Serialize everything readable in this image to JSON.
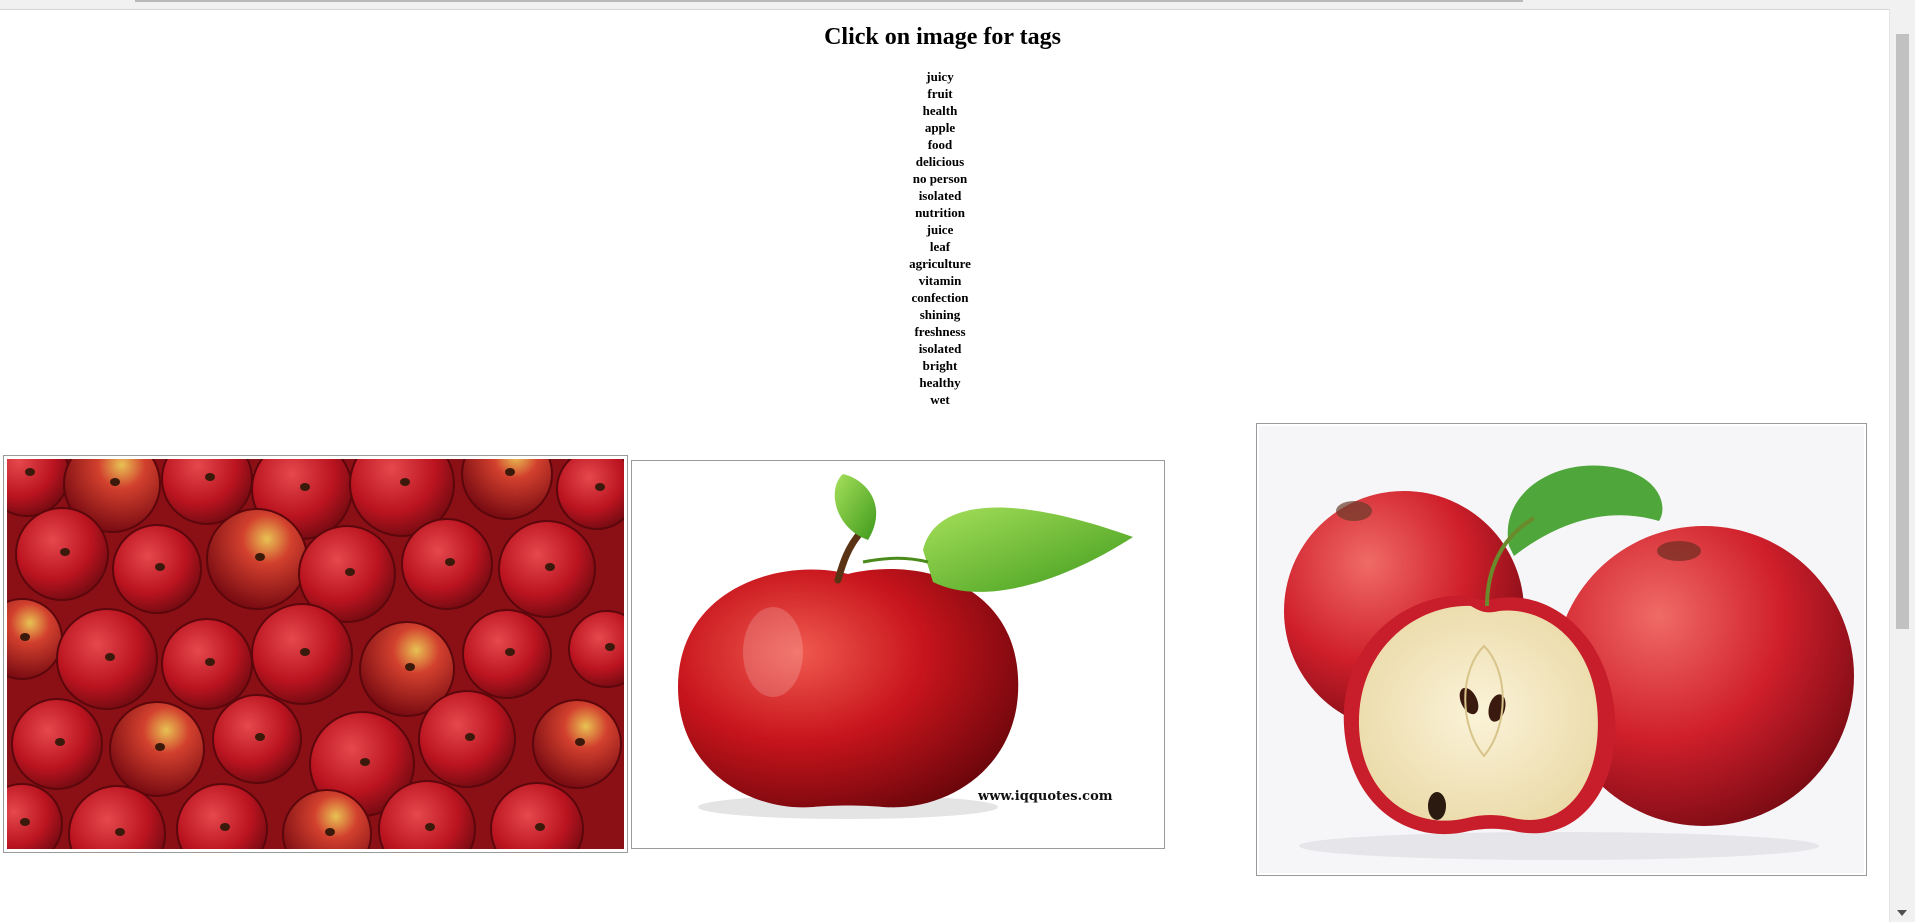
{
  "page": {
    "title": "Click on image for tags"
  },
  "tags": [
    "juicy",
    "fruit",
    "health",
    "apple",
    "food",
    "delicious",
    "no person",
    "isolated",
    "nutrition",
    "juice",
    "leaf",
    "agriculture",
    "vitamin",
    "confection",
    "shining",
    "freshness",
    "isolated",
    "bright",
    "healthy",
    "wet"
  ],
  "images": [
    {
      "name": "apples-pile-image"
    },
    {
      "name": "single-apple-image",
      "watermark": "www.iqquotes.com"
    },
    {
      "name": "apples-halved-image"
    }
  ],
  "colors": {
    "apple_red": "#c41a24",
    "apple_dark": "#7d0c12",
    "leaf_green": "#5fb52c",
    "background": "#ffffff"
  }
}
